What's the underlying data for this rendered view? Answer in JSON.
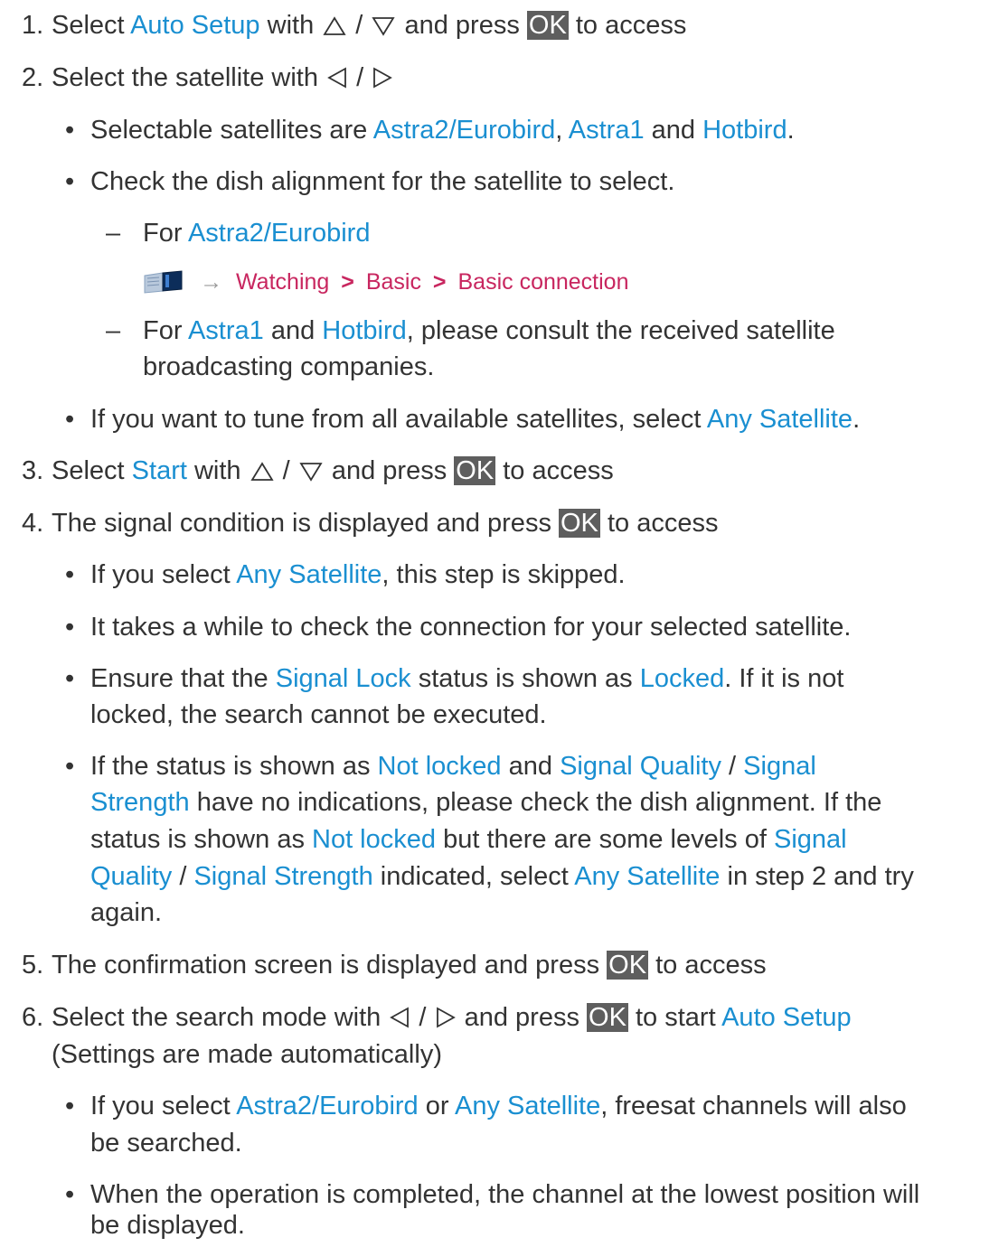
{
  "steps": {
    "s1": {
      "num": "1.",
      "pre": "Select ",
      "link": "Auto Setup",
      "mid": " with ",
      "slash": " / ",
      "post1": " and press ",
      "ok": "OK",
      "post2": " to access"
    },
    "s2": {
      "num": "2.",
      "text": "Select the satellite with ",
      "slash": " / ",
      "b1": {
        "pre": "Selectable satellites are ",
        "l1": "Astra2/Eurobird",
        "c": ", ",
        "l2": "Astra1",
        "and": " and ",
        "l3": "Hotbird",
        "end": "."
      },
      "b2": {
        "text": "Check the dish alignment for the satellite to select."
      },
      "d1": {
        "pre": "For ",
        "link": "Astra2/Eurobird"
      },
      "crumb": {
        "arrow": "→",
        "a": "Watching",
        "sep1": ">",
        "b": "Basic",
        "sep2": ">",
        "c": "Basic connection"
      },
      "d2": {
        "pre": "For ",
        "l1": "Astra1",
        "and": " and ",
        "l2": "Hotbird",
        "post": ", please consult the received satellite",
        "line2": "broadcasting companies."
      },
      "b3": {
        "pre": "If you want to tune from all available satellites, select ",
        "link": "Any Satellite",
        "end": "."
      }
    },
    "s3": {
      "num": "3.",
      "pre": "Select ",
      "link": "Start",
      "mid": " with ",
      "slash": " / ",
      "post1": " and press ",
      "ok": "OK",
      "post2": " to access"
    },
    "s4": {
      "num": "4.",
      "text": "The signal condition is displayed and press ",
      "ok": "OK",
      "post": " to access",
      "b1": {
        "pre": "If you select ",
        "link": "Any Satellite",
        "post": ", this step is skipped."
      },
      "b2": {
        "text": "It takes a while to check the connection for your selected satellite."
      },
      "b3": {
        "pre": "Ensure that the ",
        "l1": "Signal Lock",
        "mid": " status is shown as ",
        "l2": "Locked",
        "post": ". If it is not",
        "line2": "locked, the search cannot be executed."
      },
      "b4": {
        "pre": "If the status is shown as ",
        "l1": "Not locked",
        "and": " and ",
        "l2": "Signal Quality",
        "slash": " / ",
        "l3": "Signal",
        "l3b": "Strength",
        "post2": " have no indications, please check the dish alignment. If the",
        "pre3": "status is shown as ",
        "l4": "Not locked",
        "mid3": " but there are some levels of ",
        "l5": "Signal",
        "l5b": "Quality",
        "slash4": " / ",
        "l6": "Signal Strength",
        "mid4": " indicated, select ",
        "l7": "Any Satellite",
        "post4": " in step 2 and try",
        "line5": "again."
      }
    },
    "s5": {
      "num": "5.",
      "text": "The confirmation screen is displayed and press ",
      "ok": "OK",
      "post": " to access"
    },
    "s6": {
      "num": "6.",
      "pre": "Select the search mode with ",
      "slash": " / ",
      "mid": " and press ",
      "ok": "OK",
      "post": " to start ",
      "link": "Auto Setup",
      "line2": "(Settings are made automatically)",
      "b1": {
        "pre": "If you select ",
        "l1": "Astra2/Eurobird",
        "or": " or ",
        "l2": "Any Satellite",
        "post": ", freesat channels will also",
        "line2": "be searched."
      },
      "b2": {
        "text": "When the operation is completed, the channel at the lowest position will",
        "line2": "be displayed."
      }
    }
  },
  "bullet": "•",
  "dash": "–",
  "colors": {
    "link": "#1a8fd1",
    "text": "#333333",
    "crumb": "#c8265f",
    "ok_bg": "#5e5e5e"
  },
  "icons": {
    "up": "up-triangle-icon",
    "down": "down-triangle-icon",
    "left": "left-triangle-icon",
    "right": "right-triangle-icon",
    "manual": "emanual-book-icon"
  }
}
